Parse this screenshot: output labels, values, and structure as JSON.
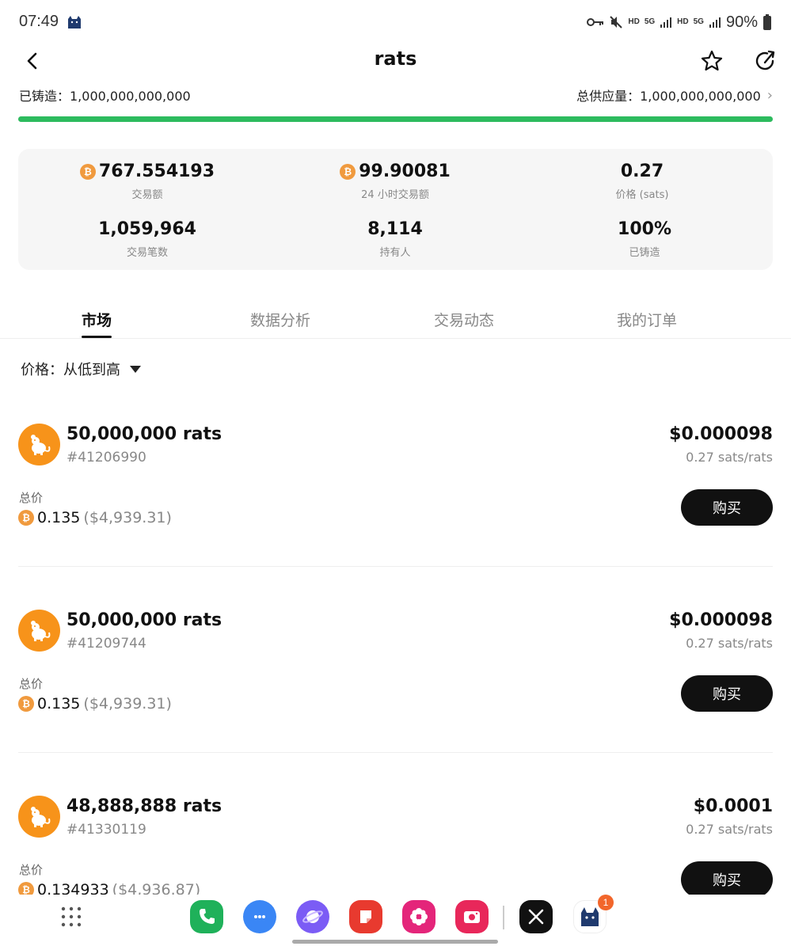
{
  "status_bar": {
    "time": "07:49",
    "hd1": "HD",
    "net1": "5G",
    "hd2": "HD",
    "net2": "5G",
    "battery": "90%"
  },
  "header": {
    "title": "rats"
  },
  "supply": {
    "minted_label": "已铸造：1,000,000,000,000",
    "total_label": "总供应量：1,000,000,000,000",
    "progress_percent": 100,
    "progress_color": "#2dbb5e"
  },
  "stats": [
    {
      "value": "767.554193",
      "label": "交易额",
      "btc": true
    },
    {
      "value": "99.90081",
      "label": "24 小时交易额",
      "btc": true
    },
    {
      "value": "0.27",
      "label": "价格 (sats)",
      "btc": false
    },
    {
      "value": "1,059,964",
      "label": "交易笔数",
      "btc": false
    },
    {
      "value": "8,114",
      "label": "持有人",
      "btc": false
    },
    {
      "value": "100%",
      "label": "已铸造",
      "btc": false
    }
  ],
  "tabs": [
    {
      "label": "市场",
      "active": true
    },
    {
      "label": "数据分析",
      "active": false
    },
    {
      "label": "交易动态",
      "active": false
    },
    {
      "label": "我的订单",
      "active": false
    }
  ],
  "sort": {
    "label": "价格：",
    "value": "从低到高"
  },
  "listings": [
    {
      "amount": "50,000,000 rats",
      "id": "#41206990",
      "price": "$0.000098",
      "rate": "0.27 sats/rats",
      "total_label": "总价",
      "total_btc": "0.135",
      "total_usd": "($4,939.31)",
      "buy": "购买"
    },
    {
      "amount": "50,000,000 rats",
      "id": "#41209744",
      "price": "$0.000098",
      "rate": "0.27 sats/rats",
      "total_label": "总价",
      "total_btc": "0.135",
      "total_usd": "($4,939.31)",
      "buy": "购买"
    },
    {
      "amount": "48,888,888 rats",
      "id": "#41330119",
      "price": "$0.0001",
      "rate": "0.27 sats/rats",
      "total_label": "总价",
      "total_btc": "0.134933",
      "total_usd": "($4,936.87)",
      "buy": "购买"
    }
  ],
  "taskbar": {
    "apps": [
      {
        "icon": "phone-icon",
        "color": "#1fb15a"
      },
      {
        "icon": "messages-icon",
        "color": "#3a86f5"
      },
      {
        "icon": "internet-icon",
        "color": "#7b5cf5"
      },
      {
        "icon": "notes-icon",
        "color": "#e83a2f"
      },
      {
        "icon": "gallery-icon",
        "color": "#e4257a"
      },
      {
        "icon": "camera-icon",
        "color": "#e8275a"
      },
      {
        "icon": "x-icon",
        "color": "#111111"
      },
      {
        "icon": "wallet-cat-icon",
        "color": "#ffffff"
      }
    ],
    "notification_badge": "1"
  }
}
